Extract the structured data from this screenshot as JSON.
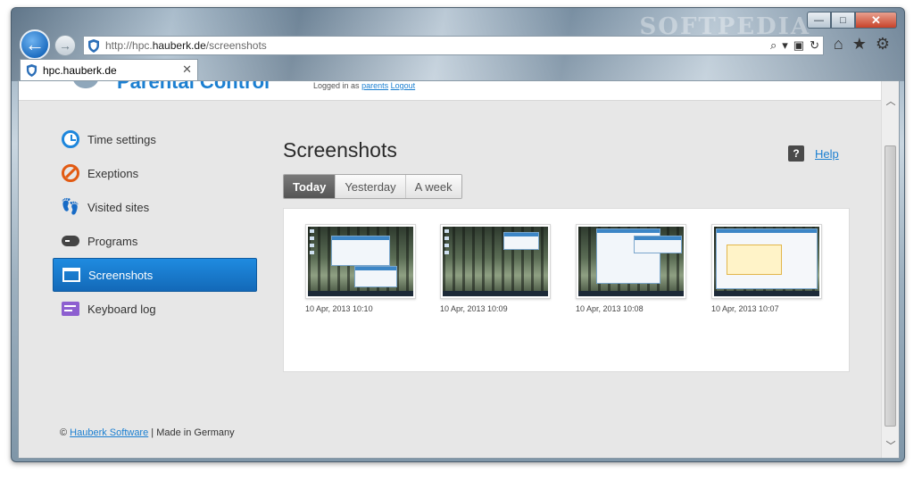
{
  "browser": {
    "url_prefix": "http://hpc.",
    "url_domain": "hauberk.de",
    "url_path": "/screenshots",
    "tab_title": "hpc.hauberk.de",
    "watermark": "SOFTPEDIA",
    "caption": {
      "minimize": "—",
      "maximize": "□",
      "close": "✕"
    },
    "back_glyph": "←",
    "forward_glyph": "→",
    "address_tools": [
      "⌕",
      "▾",
      "▣",
      "↻"
    ],
    "toolbar_icons": [
      "⌂",
      "★",
      "⚙"
    ],
    "tab_close": "✕"
  },
  "site_header": {
    "logo_text": "Parental Control",
    "links_prefix": "Logged in as",
    "link_1": "parents",
    "link_2": "Logout"
  },
  "menu": {
    "items": [
      {
        "label": "Time settings",
        "icon": "clock-icon"
      },
      {
        "label": "Exeptions",
        "icon": "ban-icon"
      },
      {
        "label": "Visited sites",
        "icon": "footsteps-icon"
      },
      {
        "label": "Programs",
        "icon": "gamepad-icon"
      },
      {
        "label": "Screenshots",
        "icon": "window-icon",
        "active": true
      },
      {
        "label": "Keyboard log",
        "icon": "keyboard-icon"
      }
    ],
    "steps_glyph": "👣"
  },
  "main": {
    "title": "Screenshots",
    "help_icon": "?",
    "help_label": "Help",
    "filters": [
      "Today",
      "Yesterday",
      "A week"
    ],
    "active_filter": "Today",
    "screenshots": [
      {
        "timestamp": "10 Apr, 2013 10:10"
      },
      {
        "timestamp": "10 Apr, 2013 10:09"
      },
      {
        "timestamp": "10 Apr, 2013 10:08"
      },
      {
        "timestamp": "10 Apr, 2013 10:07"
      }
    ]
  },
  "footer": {
    "copyright": "©",
    "company_link": "Hauberk Software",
    "separator": "|",
    "made_in": "Made in Germany"
  },
  "scrollbar": {
    "up": "︿",
    "down": "﹀"
  },
  "colors": {
    "accent": "#1b7fd1",
    "active_menu": "#1a7ad3",
    "active_filter": "#5e5e5e"
  }
}
